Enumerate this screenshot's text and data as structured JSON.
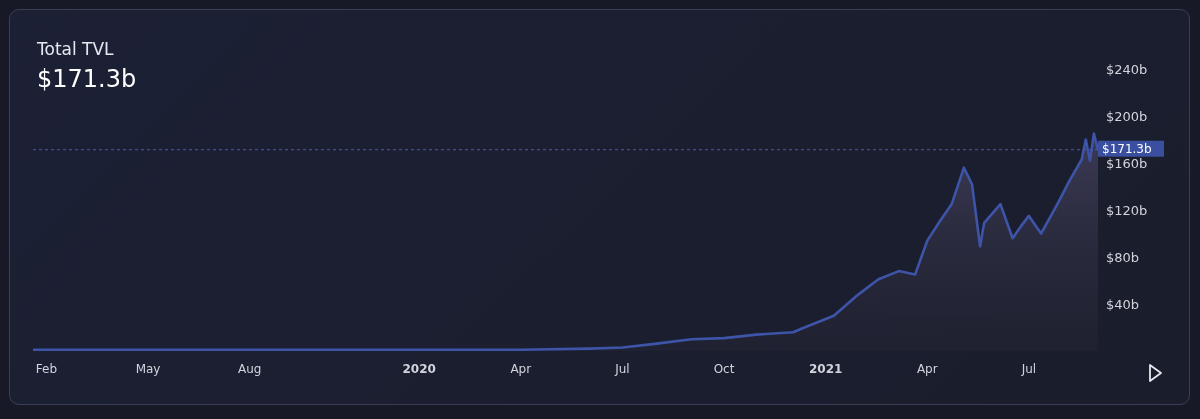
{
  "header": {
    "value": "$171.3b"
  },
  "chart_data": {
    "type": "area",
    "title": "Total TVL",
    "xlim": [
      2019.05,
      2021.67
    ],
    "ylim": [
      0,
      240
    ],
    "yticks": [
      {
        "value": 40,
        "label": "$40b"
      },
      {
        "value": 80,
        "label": "$80b"
      },
      {
        "value": 120,
        "label": "$120b"
      },
      {
        "value": 160,
        "label": "$160b"
      },
      {
        "value": 200,
        "label": "$200b"
      },
      {
        "value": 240,
        "label": "$240b"
      }
    ],
    "xticks": [
      {
        "value": 2019.083,
        "label": "Feb"
      },
      {
        "value": 2019.333,
        "label": "May"
      },
      {
        "value": 2019.583,
        "label": "Aug"
      },
      {
        "value": 2020,
        "label": "2020"
      },
      {
        "value": 2020.25,
        "label": "Apr"
      },
      {
        "value": 2020.5,
        "label": "Jul"
      },
      {
        "value": 2020.75,
        "label": "Oct"
      },
      {
        "value": 2021,
        "label": "2021"
      },
      {
        "value": 2021.25,
        "label": "Apr"
      },
      {
        "value": 2021.5,
        "label": "Jul"
      }
    ],
    "x": [
      2019.05,
      2019.33,
      2019.58,
      2019.83,
      2020.0,
      2020.25,
      2020.42,
      2020.5,
      2020.58,
      2020.67,
      2020.75,
      2020.83,
      2020.92,
      2020.94,
      2021.02,
      2021.08,
      2021.13,
      2021.18,
      2021.22,
      2021.25,
      2021.28,
      2021.31,
      2021.34,
      2021.36,
      2021.38,
      2021.39,
      2021.43,
      2021.46,
      2021.48,
      2021.5,
      2021.53,
      2021.57,
      2021.6,
      2021.63,
      2021.64,
      2021.65,
      2021.66,
      2021.67
    ],
    "series": [
      {
        "color": "#3d54a8",
        "values": [
          1,
          1,
          1,
          1,
          1,
          1,
          2,
          3,
          6,
          10,
          11,
          14,
          16,
          19,
          30,
          48,
          61,
          68,
          65,
          94,
          110,
          125,
          156,
          142,
          89,
          109,
          125,
          96,
          106,
          115,
          100,
          125,
          145,
          163,
          180,
          162,
          185,
          171
        ]
      }
    ],
    "ref_lines": [
      {
        "axis": "y",
        "value": 171.3,
        "label": "$171.3b"
      }
    ]
  }
}
